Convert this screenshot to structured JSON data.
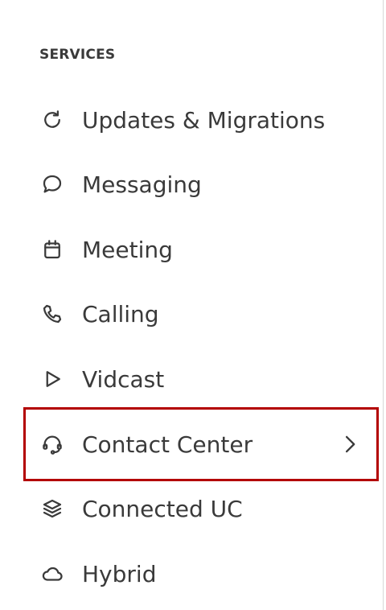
{
  "sidebar": {
    "section_title": "SERVICES",
    "items": [
      {
        "label": "Updates & Migrations",
        "icon": "refresh-icon"
      },
      {
        "label": "Messaging",
        "icon": "chat-bubble-icon"
      },
      {
        "label": "Meeting",
        "icon": "calendar-icon"
      },
      {
        "label": "Calling",
        "icon": "phone-icon"
      },
      {
        "label": "Vidcast",
        "icon": "play-icon"
      },
      {
        "label": "Contact Center",
        "icon": "headset-icon",
        "has_submenu": true,
        "highlighted": true
      },
      {
        "label": "Connected UC",
        "icon": "layers-icon"
      },
      {
        "label": "Hybrid",
        "icon": "cloud-icon"
      }
    ]
  },
  "colors": {
    "text": "#3a3a3a",
    "highlight_border": "#b30000",
    "background": "#ffffff"
  }
}
